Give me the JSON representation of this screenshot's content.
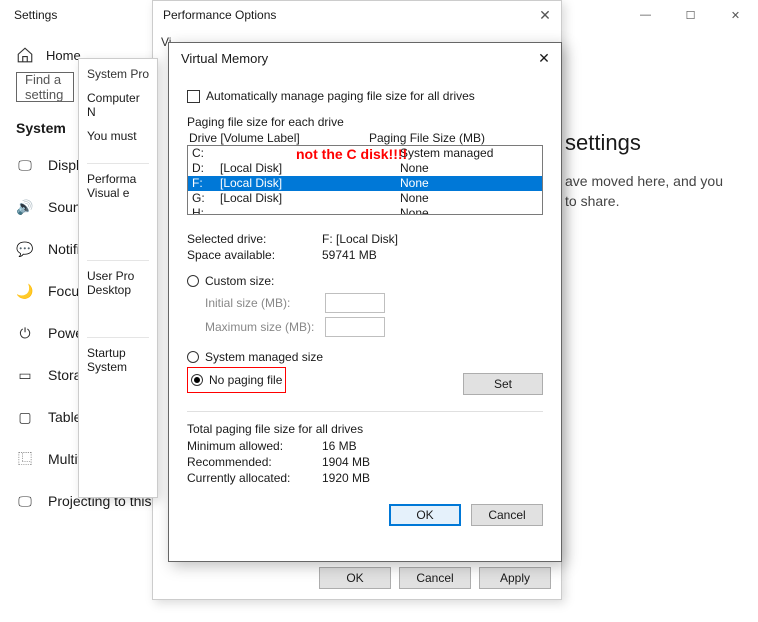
{
  "settings": {
    "title": "Settings",
    "home": "Home",
    "search_placeholder": "Find a setting",
    "section": "System",
    "nav": [
      "Display",
      "Sound",
      "Notifications",
      "Focus assist",
      "Power & sleep",
      "Storage",
      "Tablet",
      "Multitasking",
      "Projecting to this PC"
    ],
    "right_head": "settings",
    "right_body1": "ave moved here, and you",
    "right_body2": "to share."
  },
  "perf": {
    "title": "Performance Options",
    "tab": "Vi",
    "ok": "OK",
    "cancel": "Cancel",
    "apply": "Apply"
  },
  "sysprop": {
    "title": "System Pro",
    "tab": "Computer N",
    "line1": "You must",
    "sec1a": "Performa",
    "sec1b": "Visual e",
    "sec2a": "User Pro",
    "sec2b": "Desktop",
    "sec3a": "Startup",
    "sec3b": "System"
  },
  "vm": {
    "title": "Virtual Memory",
    "auto": "Automatically manage paging file size for all drives",
    "pfs_each": "Paging file size for each drive",
    "col1": "Drive  [Volume Label]",
    "col2": "Paging File Size (MB)",
    "drives": [
      {
        "d": "C:",
        "vl": "",
        "ps": "System managed"
      },
      {
        "d": "D:",
        "vl": "[Local Disk]",
        "ps": "None"
      },
      {
        "d": "F:",
        "vl": "[Local Disk]",
        "ps": "None"
      },
      {
        "d": "G:",
        "vl": "[Local Disk]",
        "ps": "None"
      },
      {
        "d": "H:",
        "vl": "",
        "ps": "None"
      }
    ],
    "annotation": "not the C disk!!!!",
    "sel_drive_lab": "Selected drive:",
    "sel_drive_val": "F:  [Local Disk]",
    "space_lab": "Space available:",
    "space_val": "59741 MB",
    "custom": "Custom size:",
    "init_lab": "Initial size (MB):",
    "max_lab": "Maximum size (MB):",
    "sys_managed": "System managed size",
    "no_paging": "No paging file",
    "set": "Set",
    "total_head": "Total paging file size for all drives",
    "min_lab": "Minimum allowed:",
    "min_val": "16 MB",
    "rec_lab": "Recommended:",
    "rec_val": "1904 MB",
    "cur_lab": "Currently allocated:",
    "cur_val": "1920 MB",
    "ok": "OK",
    "cancel": "Cancel"
  }
}
